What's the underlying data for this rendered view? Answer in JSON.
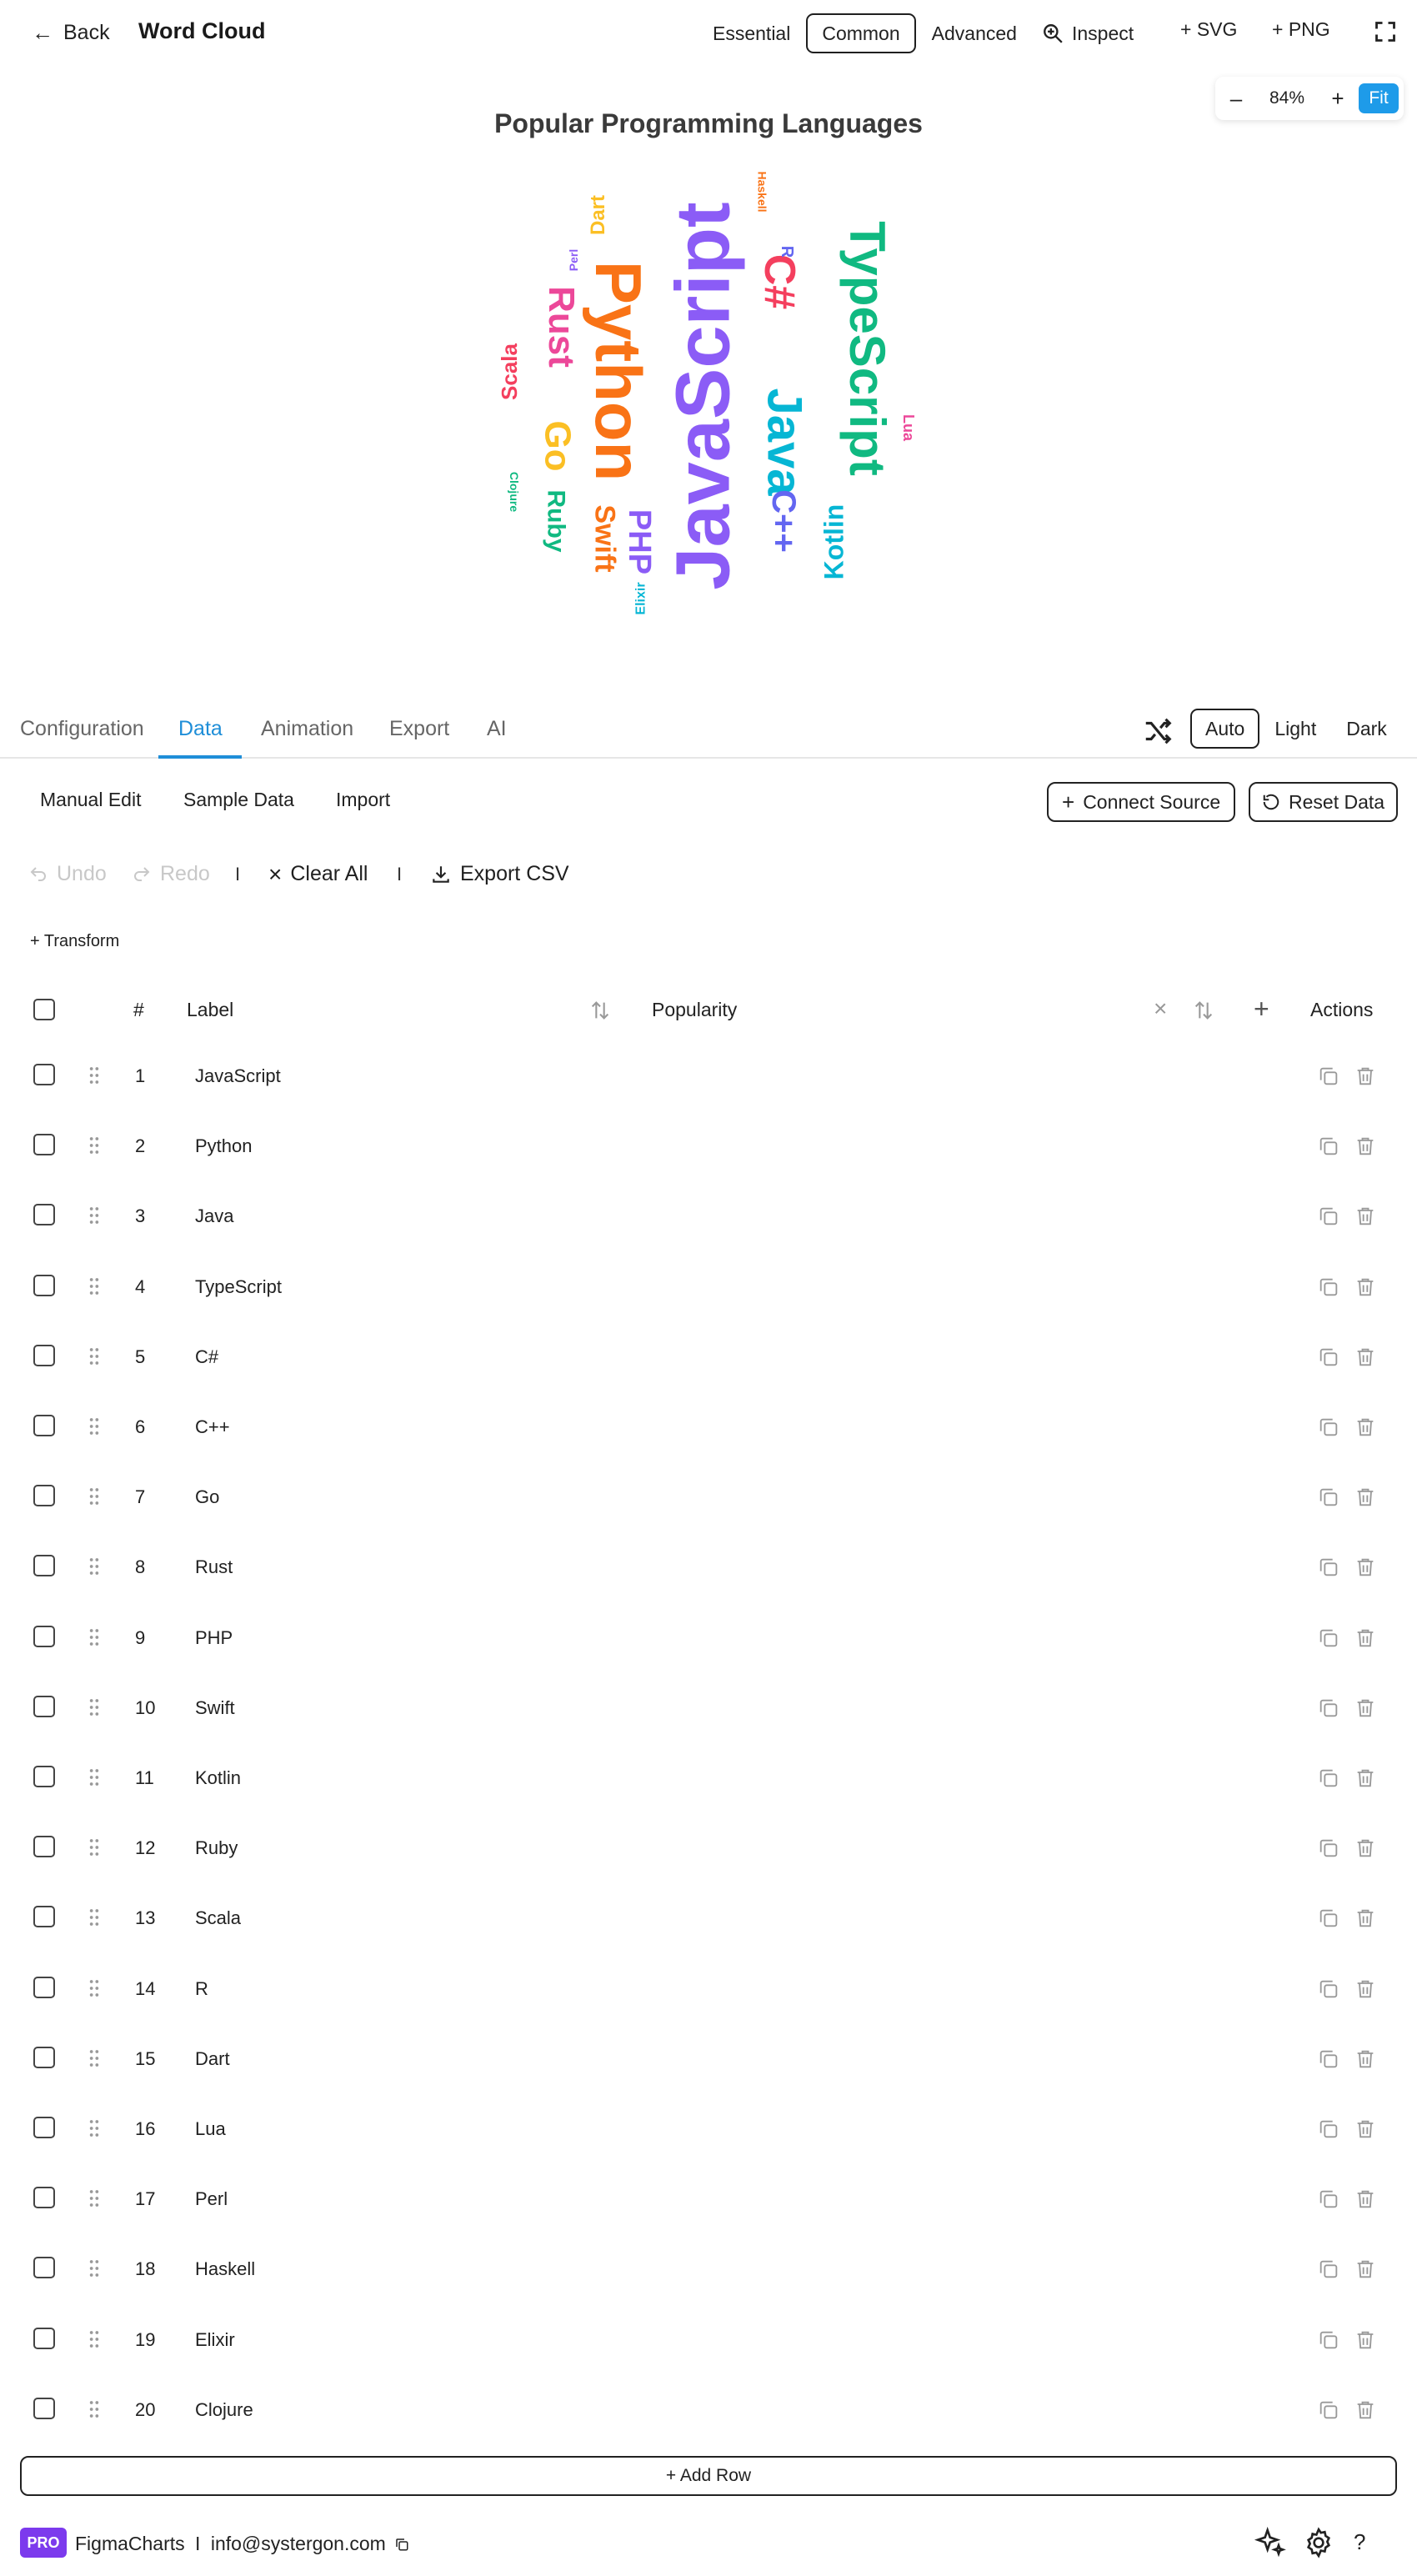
{
  "topbar": {
    "back_label": "Back",
    "app_title": "Word Cloud",
    "modes": [
      "Essential",
      "Common",
      "Advanced"
    ],
    "active_mode": "Common",
    "inspect_label": "Inspect",
    "svg_label": "+ SVG",
    "png_label": "+ PNG"
  },
  "zoom": {
    "minus": "–",
    "value": "84%",
    "plus": "+",
    "fit": "Fit"
  },
  "tabs": {
    "items": [
      "Configuration",
      "Data",
      "Animation",
      "Export",
      "AI"
    ],
    "active": "Data",
    "themes": [
      "Auto",
      "Light",
      "Dark"
    ],
    "active_theme": "Auto"
  },
  "data_toolbar": {
    "sub_tabs": [
      "Manual Edit",
      "Sample Data",
      "Import"
    ],
    "connect_label": "Connect Source",
    "reset_label": "Reset Data",
    "undo_label": "Undo",
    "redo_label": "Redo",
    "clear_label": "Clear All",
    "export_csv_label": "Export CSV",
    "transform_label": "+ Transform"
  },
  "table": {
    "headers": {
      "num": "#",
      "label": "Label",
      "value": "Popularity",
      "actions": "Actions"
    },
    "rows": [
      {
        "n": "1",
        "label": "JavaScript"
      },
      {
        "n": "2",
        "label": "Python"
      },
      {
        "n": "3",
        "label": "Java"
      },
      {
        "n": "4",
        "label": "TypeScript"
      },
      {
        "n": "5",
        "label": "C#"
      },
      {
        "n": "6",
        "label": "C++"
      },
      {
        "n": "7",
        "label": "Go"
      },
      {
        "n": "8",
        "label": "Rust"
      },
      {
        "n": "9",
        "label": "PHP"
      },
      {
        "n": "10",
        "label": "Swift"
      },
      {
        "n": "11",
        "label": "Kotlin"
      },
      {
        "n": "12",
        "label": "Ruby"
      },
      {
        "n": "13",
        "label": "Scala"
      },
      {
        "n": "14",
        "label": "R"
      },
      {
        "n": "15",
        "label": "Dart"
      },
      {
        "n": "16",
        "label": "Lua"
      },
      {
        "n": "17",
        "label": "Perl"
      },
      {
        "n": "18",
        "label": "Haskell"
      },
      {
        "n": "19",
        "label": "Elixir"
      },
      {
        "n": "20",
        "label": "Clojure"
      }
    ],
    "add_row_label": "+ Add Row"
  },
  "footer": {
    "badge": "PRO",
    "brand": "FigmaCharts",
    "separator": "I",
    "email": "info@systergon.com",
    "help": "?"
  },
  "colors": {
    "accent": "#1e9be9",
    "pro": "#7c3aed",
    "orange": "#f97316",
    "purple": "#8b5cf6",
    "teal": "#06b6d4",
    "green": "#10b981",
    "pink": "#ec4899",
    "red": "#f43f5e",
    "yellow": "#fbbf24",
    "indigo": "#6366f1"
  },
  "chart_data": {
    "type": "wordcloud",
    "title": "Popular Programming Languages",
    "words": [
      {
        "text": "JavaScript",
        "color": "#8b5cf6",
        "orientation": "vertical"
      },
      {
        "text": "Python",
        "color": "#f97316",
        "orientation": "vertical"
      },
      {
        "text": "Java",
        "color": "#06b6d4",
        "orientation": "vertical"
      },
      {
        "text": "TypeScript",
        "color": "#10b981",
        "orientation": "vertical"
      },
      {
        "text": "C#",
        "color": "#f43f5e",
        "orientation": "vertical"
      },
      {
        "text": "C++",
        "color": "#6366f1",
        "orientation": "vertical"
      },
      {
        "text": "Go",
        "color": "#fbbf24",
        "orientation": "vertical"
      },
      {
        "text": "Rust",
        "color": "#ec4899",
        "orientation": "vertical"
      },
      {
        "text": "PHP",
        "color": "#8b5cf6",
        "orientation": "vertical"
      },
      {
        "text": "Swift",
        "color": "#f97316",
        "orientation": "vertical"
      },
      {
        "text": "Kotlin",
        "color": "#06b6d4",
        "orientation": "vertical"
      },
      {
        "text": "Ruby",
        "color": "#10b981",
        "orientation": "vertical"
      },
      {
        "text": "Scala",
        "color": "#f43f5e",
        "orientation": "vertical"
      },
      {
        "text": "R",
        "color": "#6366f1",
        "orientation": "vertical"
      },
      {
        "text": "Dart",
        "color": "#fbbf24",
        "orientation": "vertical"
      },
      {
        "text": "Lua",
        "color": "#ec4899",
        "orientation": "vertical"
      },
      {
        "text": "Perl",
        "color": "#8b5cf6",
        "orientation": "vertical"
      },
      {
        "text": "Haskell",
        "color": "#f97316",
        "orientation": "vertical"
      },
      {
        "text": "Elixir",
        "color": "#06b6d4",
        "orientation": "vertical"
      },
      {
        "text": "Clojure",
        "color": "#10b981",
        "orientation": "vertical"
      }
    ]
  }
}
